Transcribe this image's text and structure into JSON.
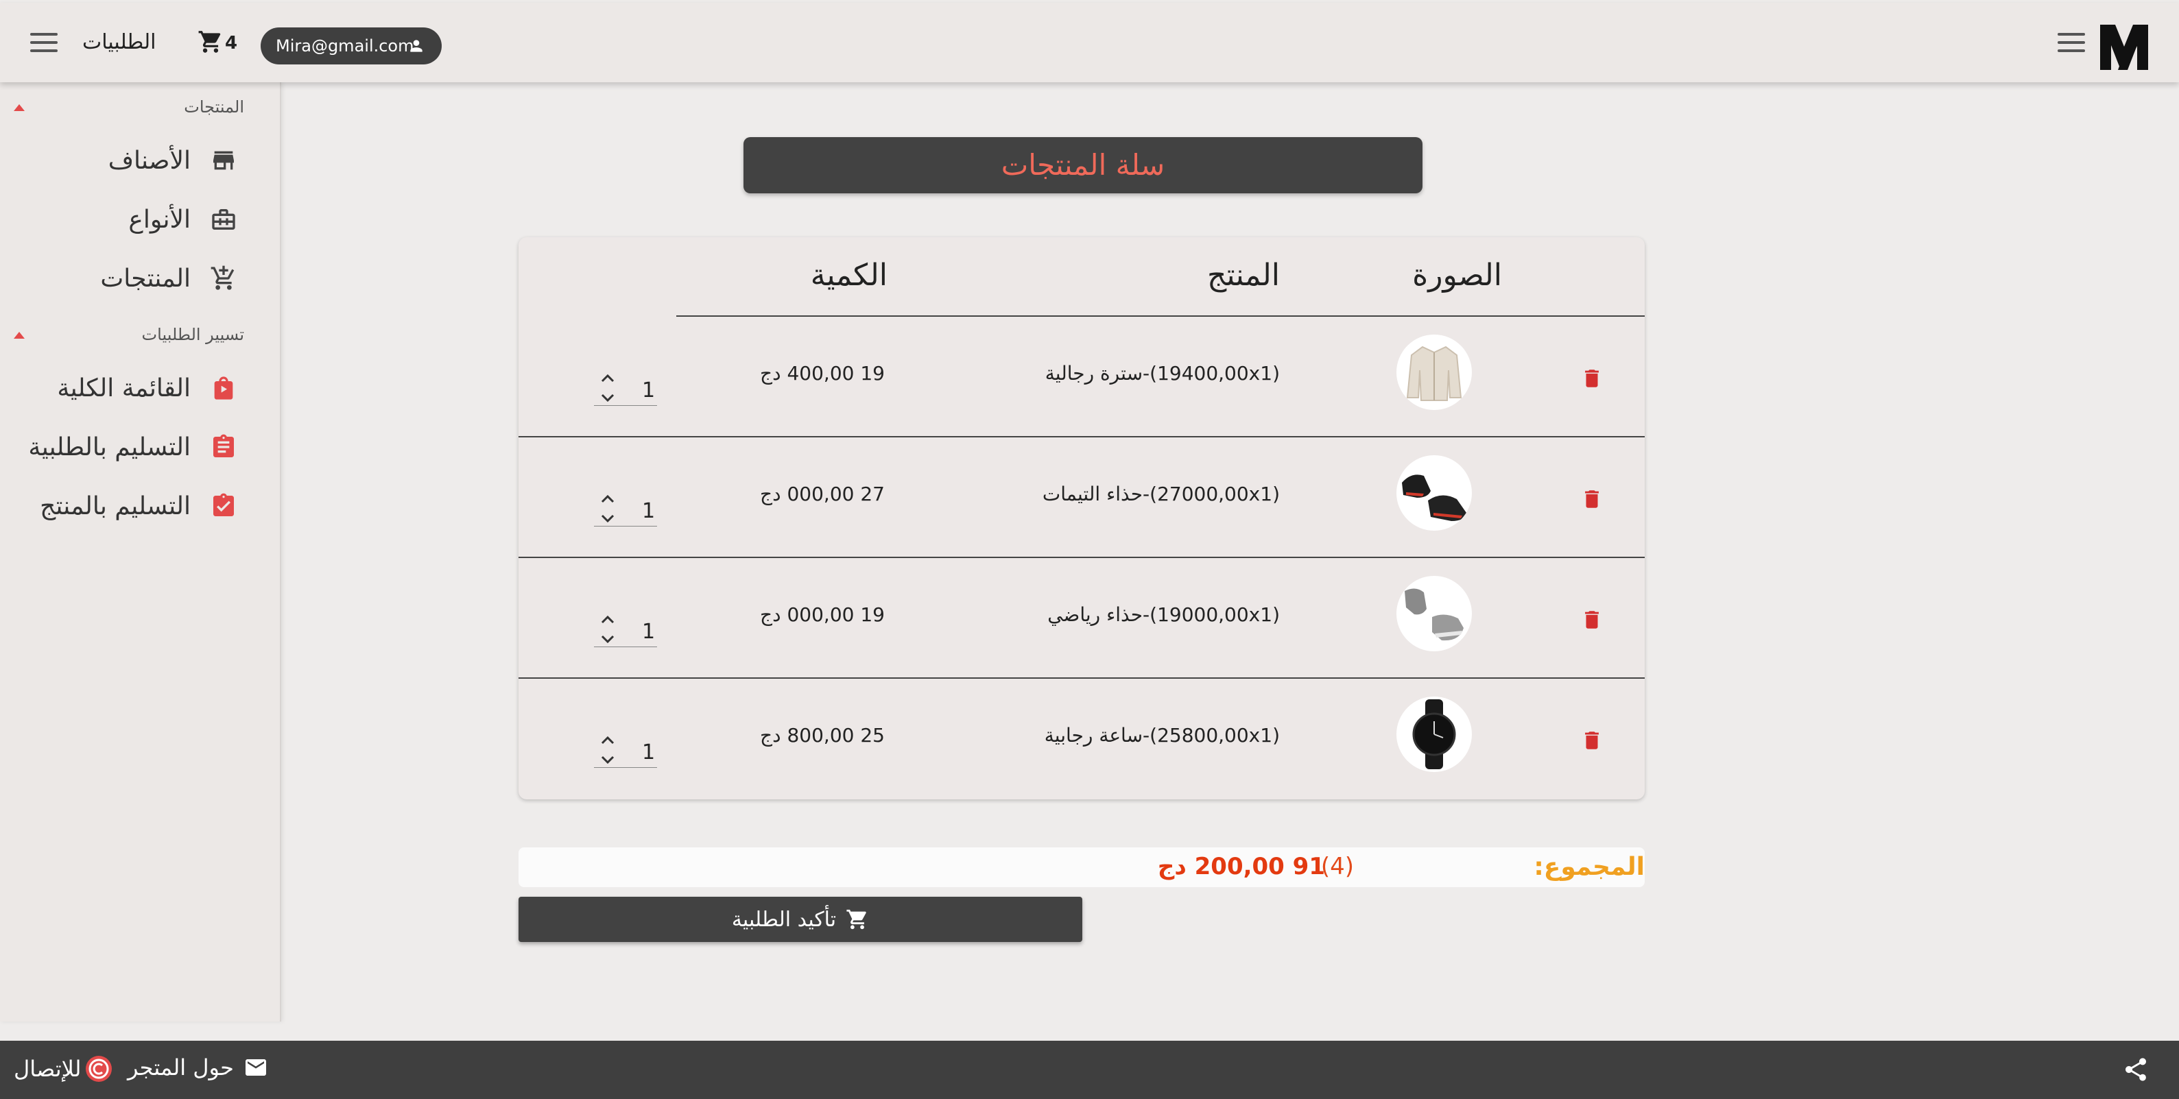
{
  "topbar": {
    "orders_label": "الطلبيات",
    "cart_count": "4",
    "user_email": "Mira@gmail.com"
  },
  "sidebar": {
    "section_products": "المنتجات",
    "section_orders": "تسيير الطلبيات",
    "items": [
      {
        "label": "الأصناف",
        "icon": "store-icon"
      },
      {
        "label": "الأنواع",
        "icon": "briefcase-icon"
      },
      {
        "label": "المنتجات",
        "icon": "cart-add-icon"
      },
      {
        "label": "القائمة الكلية",
        "icon": "bag-icon"
      },
      {
        "label": "التسليم بالطلبية",
        "icon": "clipboard-list-icon"
      },
      {
        "label": "التسليم بالمنتج",
        "icon": "clipboard-check-icon"
      }
    ]
  },
  "page": {
    "title": "سلة المنتجات"
  },
  "cart_table": {
    "headers": {
      "image": "الصورة",
      "product": "المنتج",
      "quantity": "الكمية"
    },
    "rows": [
      {
        "product": "(19400,00x1)-سترة رجالية",
        "price": "19 400,00 دج",
        "qty": "1",
        "image": "jacket"
      },
      {
        "product": "(27000,00x1)-حذاء التيمات",
        "price": "27 000,00 دج",
        "qty": "1",
        "image": "sneakers-black-red"
      },
      {
        "product": "(19000,00x1)-حذاء رياضي",
        "price": "19 000,00 دج",
        "qty": "1",
        "image": "sneakers-grey"
      },
      {
        "product": "(25800,00x1)-ساعة رجابية",
        "price": "25 800,00 دج",
        "qty": "1",
        "image": "watch"
      }
    ]
  },
  "summary": {
    "total_label": "المجموع:",
    "total_count": "(4)",
    "total_amount": "91 200,00 دج",
    "confirm_label": "تأكيد الطلبية"
  },
  "footer": {
    "contact_label": "للإتصال",
    "about_label": "حول المتجر"
  },
  "colors": {
    "accent": "#e34a4a",
    "title_text": "#f06a5a",
    "dark": "#424242",
    "total_label": "#f0a020"
  }
}
